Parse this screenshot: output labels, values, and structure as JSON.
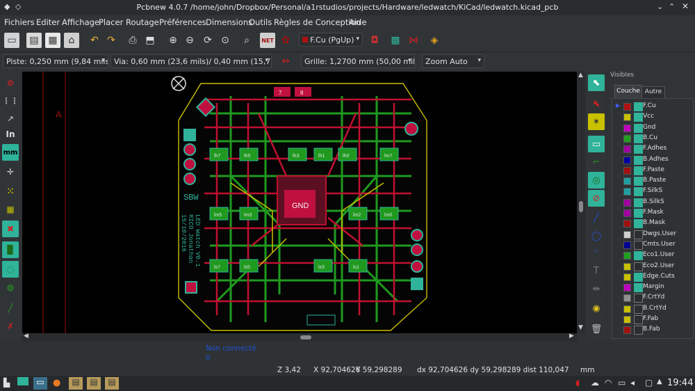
{
  "window": {
    "title": "Pcbnew 4.0.7 /home/john/Dropbox/Personal/a1rstudios/projects/Hardware/ledwatch/KiCad/ledwatch.kicad_pcb"
  },
  "menu": [
    "Fichiers",
    "Editer",
    "Affichage",
    "Placer",
    "Routage",
    "Préférences",
    "Dimensions",
    "Outils",
    "Règles de Conception",
    "Aide"
  ],
  "toolbar": {
    "layer_select": "F.Cu (PgUp)",
    "track_width": "Piste: 0,250 mm (9,84 mils) *",
    "via_size": "Via: 0,60 mm (23,6 mils)/ 0,40 mm (15,7 mils) *",
    "grid": "Grille: 1,2700 mm (50,00 mils)",
    "zoom": "Zoom Auto",
    "netlist_icon_label": "NET"
  },
  "left_tools": {
    "units_in": "In",
    "units_mm": "mm"
  },
  "board": {
    "gnd_label": "GND",
    "silk_sbw": "SBW",
    "silk_text": [
      "LED Watch V0.1",
      "RICO Jonathan",
      "15/10/2016"
    ],
    "ruler_letter": "A",
    "pad_numbers": [
      "7",
      "8"
    ],
    "footprints": [
      "lh7",
      "lh5",
      "lh3",
      "lh1",
      "lh0",
      "lm7",
      "lm5",
      "lm3",
      "lm2",
      "lm0",
      "ls7",
      "ls5",
      "ls3",
      "ls1"
    ]
  },
  "layers_panel": {
    "header": "Visibles",
    "tabs": [
      "Couche",
      "Autre"
    ],
    "items": [
      {
        "name": "F.Cu",
        "color": "#b01010",
        "checked": true,
        "active": true
      },
      {
        "name": "Vcc",
        "color": "#c8c000",
        "checked": true
      },
      {
        "name": "Gnd",
        "color": "#c000c0",
        "checked": true
      },
      {
        "name": "B.Cu",
        "color": "#20a020",
        "checked": true
      },
      {
        "name": "F.Adhes",
        "color": "#a000a0",
        "checked": true
      },
      {
        "name": "B.Adhes",
        "color": "#0000a0",
        "checked": true
      },
      {
        "name": "F.Paste",
        "color": "#a01010",
        "checked": true
      },
      {
        "name": "B.Paste",
        "color": "#20a0a0",
        "checked": true
      },
      {
        "name": "F.SilkS",
        "color": "#20a0a0",
        "checked": true
      },
      {
        "name": "B.SilkS",
        "color": "#a000a0",
        "checked": true
      },
      {
        "name": "F.Mask",
        "color": "#a000a0",
        "checked": true
      },
      {
        "name": "B.Mask",
        "color": "#a01010",
        "checked": true
      },
      {
        "name": "Dwgs.User",
        "color": "#d0d0d0",
        "checked": false
      },
      {
        "name": "Cmts.User",
        "color": "#000090",
        "checked": false
      },
      {
        "name": "Eco1.User",
        "color": "#20a020",
        "checked": true
      },
      {
        "name": "Eco2.User",
        "color": "#c8c000",
        "checked": false
      },
      {
        "name": "Edge.Cuts",
        "color": "#c8c000",
        "checked": true
      },
      {
        "name": "Margin",
        "color": "#c000c0",
        "checked": true
      },
      {
        "name": "F.CrtYd",
        "color": "#909090",
        "checked": false
      },
      {
        "name": "B.CrtYd",
        "color": "#c8c000",
        "checked": false
      },
      {
        "name": "F.Fab",
        "color": "#c8c000",
        "checked": false
      },
      {
        "name": "B.Fab",
        "color": "#a01010",
        "checked": false
      }
    ]
  },
  "messages": {
    "unconnected_label": "Non connecté",
    "unconnected_value": "0"
  },
  "status": {
    "zoom": "Z 3,42",
    "x": "X 92,704626",
    "y": "Y 59,298289",
    "dx_dy": "dx 92,704626  dy 59,298289  dist 110,047",
    "units": "mm"
  },
  "taskbar": {
    "clock": "19:44"
  },
  "colors": {
    "accent": "#2fb39a",
    "board_bg": "#000000",
    "cu_front": "#b01030",
    "cu_back": "#1f9a1f"
  }
}
